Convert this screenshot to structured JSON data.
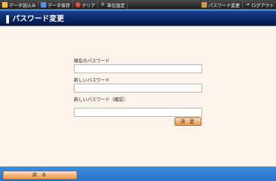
{
  "toolbar": {
    "load_label": "データ読込み",
    "save_label": "データ保存",
    "clear_label": "クリア",
    "units_label": "単位設定",
    "password_label": "パスワード変更",
    "logout_label": "ログアウト"
  },
  "page": {
    "title": "パスワード変更"
  },
  "form": {
    "current_label": "現在のパスワード",
    "current_value": "",
    "new_label": "新しいパスワード",
    "new_value": "",
    "confirm_label": "新しいパスワード（確認）",
    "confirm_value": "",
    "ok_label": "決 定"
  },
  "footer": {
    "back_label": "戻 る"
  },
  "colors": {
    "title_bar": "#0b2766",
    "panel_bg": "#fcf3ea",
    "button_orange": "#f5b57c",
    "page_bg": "#2f7ad0"
  }
}
